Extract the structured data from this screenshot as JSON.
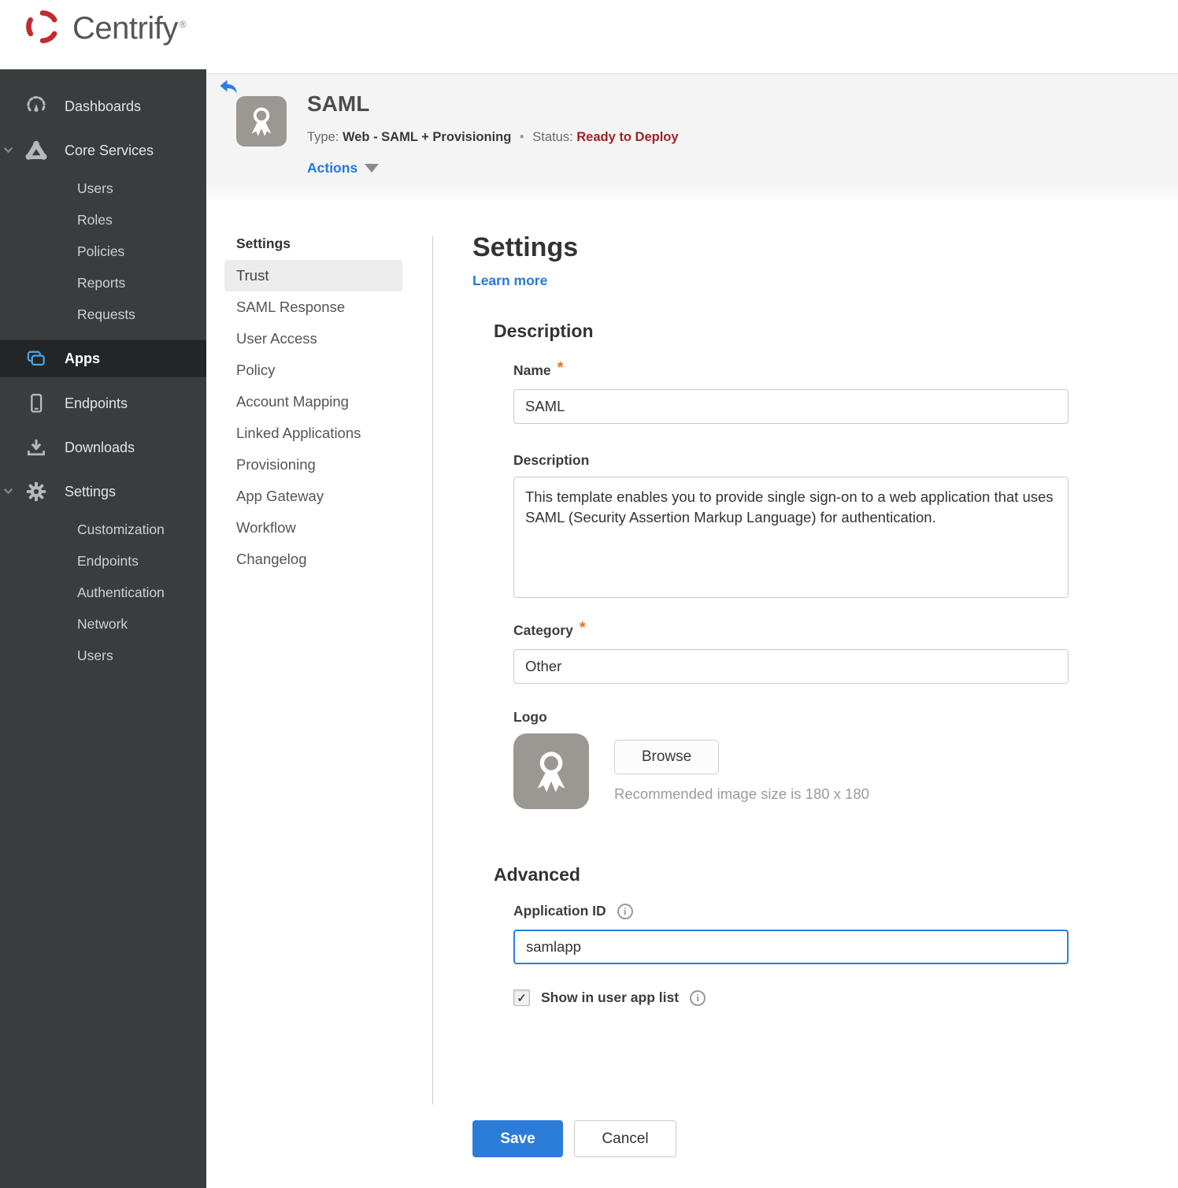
{
  "brand": {
    "name": "Centrify",
    "trademark": "®"
  },
  "sidebar": {
    "items": [
      {
        "label": "Dashboards",
        "icon": "gauge-icon"
      },
      {
        "label": "Core Services",
        "icon": "core-services-icon",
        "expanded": true,
        "children": [
          "Users",
          "Roles",
          "Policies",
          "Reports",
          "Requests"
        ]
      },
      {
        "label": "Apps",
        "icon": "apps-icon",
        "active": true
      },
      {
        "label": "Endpoints",
        "icon": "device-icon"
      },
      {
        "label": "Downloads",
        "icon": "download-icon"
      },
      {
        "label": "Settings",
        "icon": "gear-icon",
        "expanded": true,
        "children": [
          "Customization",
          "Endpoints",
          "Authentication",
          "Network",
          "Users"
        ]
      }
    ]
  },
  "page_header": {
    "title": "SAML",
    "type_label": "Type:",
    "type_value": "Web - SAML + Provisioning",
    "separator": "•",
    "status_label": "Status:",
    "status_value": "Ready to Deploy",
    "actions_label": "Actions"
  },
  "secondary_nav": {
    "header": "Settings",
    "active": "Trust",
    "items": [
      "Trust",
      "SAML Response",
      "User Access",
      "Policy",
      "Account Mapping",
      "Linked Applications",
      "Provisioning",
      "App Gateway",
      "Workflow",
      "Changelog"
    ]
  },
  "content": {
    "title": "Settings",
    "learn_more": "Learn more",
    "required_marker": "*",
    "description_section": {
      "heading": "Description",
      "name_label": "Name",
      "name_value": "SAML",
      "description_label": "Description",
      "description_value": "This template enables you to provide single sign-on to a web application that uses SAML (Security Assertion Markup Language) for authentication.",
      "category_label": "Category",
      "category_value": "Other",
      "logo_label": "Logo",
      "browse_label": "Browse",
      "logo_hint": "Recommended image size is 180 x 180"
    },
    "advanced_section": {
      "heading": "Advanced",
      "app_id_label": "Application ID",
      "app_id_value": "samlapp",
      "show_in_list_label": "Show in user app list",
      "show_in_list_checked": true
    },
    "buttons": {
      "save": "Save",
      "cancel": "Cancel"
    }
  },
  "icons": {
    "checkbox_check": "✓",
    "info_glyph": "i"
  },
  "colors": {
    "sidebar_bg": "#3a3d3e",
    "sidebar_active_bg": "#232627",
    "accent_blue": "#2b7cd9",
    "link_blue": "#2479de",
    "focus_blue": "#2a7fd4",
    "status_red": "#a31f22",
    "asterisk_orange": "#e8711f",
    "header_band": "#f4f4f4",
    "apps_icon_blue": "#4ba4e3",
    "brand_red": "#bf2b30"
  }
}
